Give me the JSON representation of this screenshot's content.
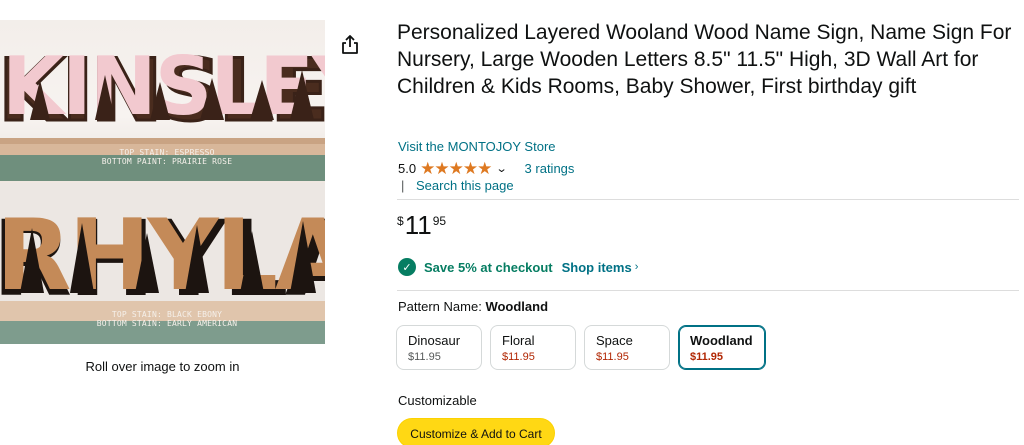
{
  "gallery": {
    "zoom_hint": "Roll over image to zoom in",
    "images": [
      {
        "word": "KINSLEY",
        "caption_line1": "TOP STAIN: ESPRESSO",
        "caption_line2": "BOTTOM PAINT: PRAIRIE ROSE"
      },
      {
        "word": "RHYLAN",
        "caption_line1": "TOP STAIN: BLACK EBONY",
        "caption_line2": "BOTTOM STAIN: EARLY AMERICAN"
      }
    ],
    "share_icon": "share-icon"
  },
  "product": {
    "title": "Personalized Layered Wooland Wood Name Sign, Name Sign For Nursery, Large Wooden Letters 8.5\" 11.5\" High, 3D Wall Art for Children & Kids Rooms, Baby Shower, First birthday gift",
    "store_link": "Visit the MONTOJOY Store",
    "rating": {
      "value": "5.0",
      "stars": 5,
      "ratings_label": "3 ratings"
    },
    "search_separator": "|",
    "search_link": "Search this page"
  },
  "price": {
    "symbol": "$",
    "whole": "11",
    "fraction": "95"
  },
  "promo": {
    "text": "Save 5% at checkout",
    "link": "Shop items",
    "icon": "check-circle-icon"
  },
  "pattern": {
    "label": "Pattern Name:",
    "selected": "Woodland",
    "options": [
      {
        "name": "Dinosaur",
        "price": "$11.95"
      },
      {
        "name": "Floral",
        "price": "$11.95"
      },
      {
        "name": "Space",
        "price": "$11.95"
      },
      {
        "name": "Woodland",
        "price": "$11.95"
      }
    ]
  },
  "customize": {
    "label": "Customizable",
    "button": "Customize & Add to Cart"
  },
  "colors": {
    "link": "#007185",
    "promo_green": "#067d62",
    "star": "#de7921",
    "button": "#ffd814",
    "deal_red": "#b12704"
  }
}
